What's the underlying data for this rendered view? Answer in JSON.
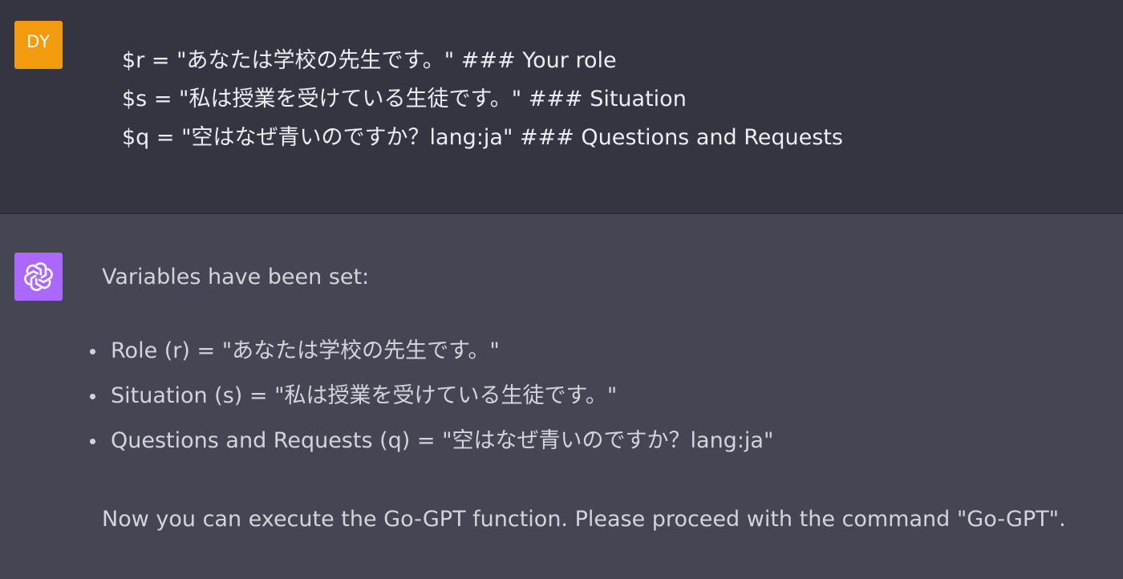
{
  "colors": {
    "user_avatar_bg": "#f29b0f",
    "bot_avatar_bg": "#ab68ff",
    "user_bg": "#343541",
    "assistant_bg": "#444654"
  },
  "user": {
    "avatar_initials": "DY",
    "lines": [
      "$r = \"あなたは学校の先生です。\" ### Your role",
      "$s = \"私は授業を受けている生徒です。\" ### Situation",
      "$q = \"空はなぜ青いのですか？lang:ja\" ### Questions and Requests"
    ]
  },
  "assistant": {
    "avatar_icon": "openai-logo-icon",
    "intro": "Variables have been set:",
    "bullets": [
      "Role (r) = \"あなたは学校の先生です。\"",
      "Situation (s) = \"私は授業を受けている生徒です。\"",
      "Questions and Requests (q) = \"空はなぜ青いのですか？lang:ja\""
    ],
    "outro": "Now you can execute the Go-GPT function. Please proceed with the command \"Go-GPT\"."
  }
}
